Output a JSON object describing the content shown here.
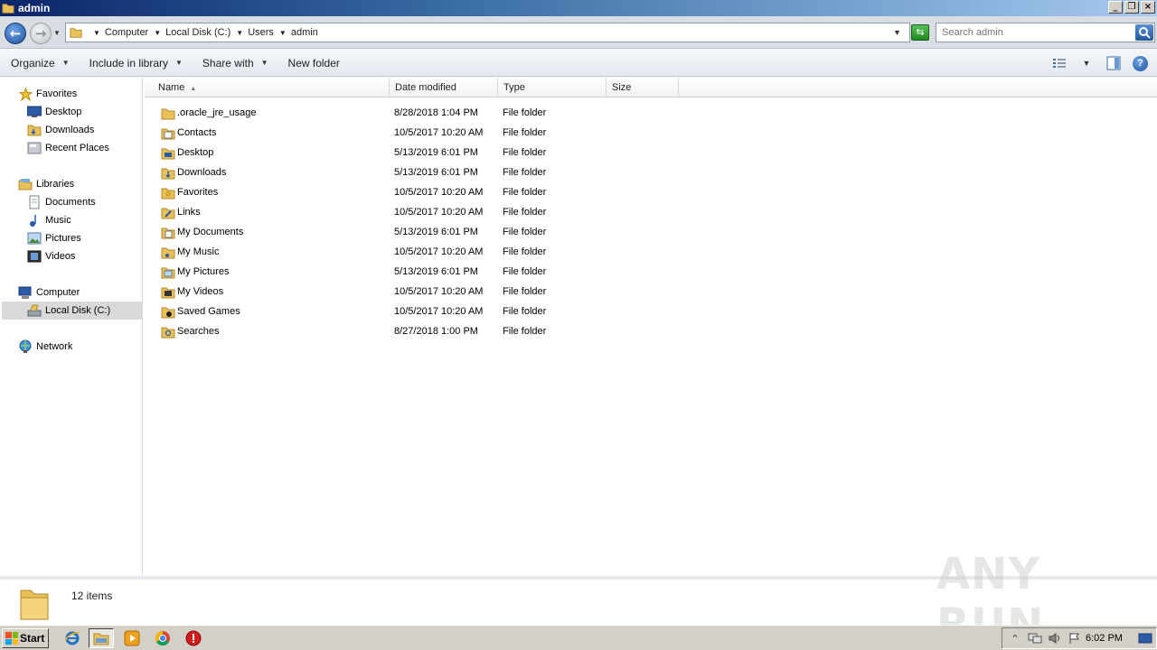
{
  "window": {
    "title": "admin"
  },
  "address": {
    "breadcrumbs": [
      "Computer",
      "Local Disk (C:)",
      "Users",
      "admin"
    ]
  },
  "search": {
    "placeholder": "Search admin"
  },
  "toolbar": {
    "organize": "Organize",
    "include_in_library": "Include in library",
    "share_with": "Share with",
    "new_folder": "New folder"
  },
  "sidebar": {
    "favorites": "Favorites",
    "fav_items": [
      "Desktop",
      "Downloads",
      "Recent Places"
    ],
    "libraries": "Libraries",
    "lib_items": [
      "Documents",
      "Music",
      "Pictures",
      "Videos"
    ],
    "computer": "Computer",
    "computer_items": [
      "Local Disk (C:)"
    ],
    "network": "Network"
  },
  "columns": {
    "name": "Name",
    "date": "Date modified",
    "type": "Type",
    "size": "Size"
  },
  "files": [
    {
      "name": ".oracle_jre_usage",
      "date": "8/28/2018 1:04 PM",
      "type": "File folder"
    },
    {
      "name": "Contacts",
      "date": "10/5/2017 10:20 AM",
      "type": "File folder"
    },
    {
      "name": "Desktop",
      "date": "5/13/2019 6:01 PM",
      "type": "File folder"
    },
    {
      "name": "Downloads",
      "date": "5/13/2019 6:01 PM",
      "type": "File folder"
    },
    {
      "name": "Favorites",
      "date": "10/5/2017 10:20 AM",
      "type": "File folder"
    },
    {
      "name": "Links",
      "date": "10/5/2017 10:20 AM",
      "type": "File folder"
    },
    {
      "name": "My Documents",
      "date": "5/13/2019 6:01 PM",
      "type": "File folder"
    },
    {
      "name": "My Music",
      "date": "10/5/2017 10:20 AM",
      "type": "File folder"
    },
    {
      "name": "My Pictures",
      "date": "5/13/2019 6:01 PM",
      "type": "File folder"
    },
    {
      "name": "My Videos",
      "date": "10/5/2017 10:20 AM",
      "type": "File folder"
    },
    {
      "name": "Saved Games",
      "date": "10/5/2017 10:20 AM",
      "type": "File folder"
    },
    {
      "name": "Searches",
      "date": "8/27/2018 1:00 PM",
      "type": "File folder"
    }
  ],
  "details": {
    "count": "12 items"
  },
  "taskbar": {
    "start": "Start",
    "clock": "6:02 PM"
  },
  "watermark": "ANY RUN",
  "colors": {
    "folder": "#e8c15a",
    "accent": "#1d4f9c",
    "selection": "#d9d9d9"
  }
}
